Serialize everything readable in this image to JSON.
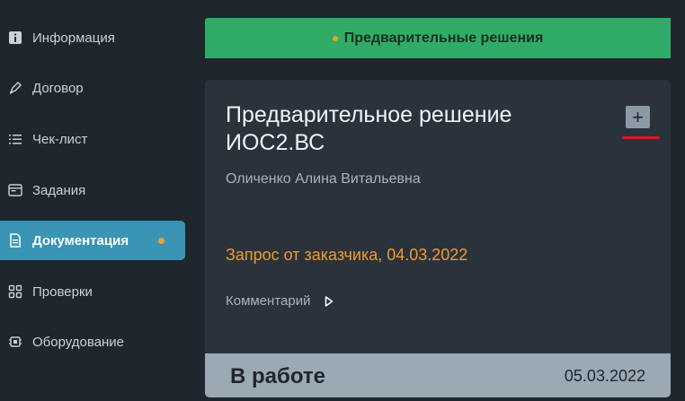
{
  "sidebar": {
    "items": [
      {
        "label": "Информация",
        "icon": "info-icon",
        "active": false
      },
      {
        "label": "Договор",
        "icon": "pen-icon",
        "active": false
      },
      {
        "label": "Чек-лист",
        "icon": "checklist-icon",
        "active": false
      },
      {
        "label": "Задания",
        "icon": "tasks-icon",
        "active": false
      },
      {
        "label": "Документация",
        "icon": "document-icon",
        "active": true,
        "has_badge_dot": true
      },
      {
        "label": "Проверки",
        "icon": "grid-icon",
        "active": false
      },
      {
        "label": "Оборудование",
        "icon": "chip-icon",
        "active": false
      }
    ]
  },
  "banner": {
    "label": "Предварительные решения"
  },
  "card": {
    "title": "Предварительное решение ИОС2.ВС",
    "add_label": "+",
    "person": "Оличенко Алина Витальевна",
    "request": "Запрос от заказчика, 04.03.2022",
    "comment_label": "Комментарий",
    "status": "В работе",
    "status_date": "05.03.2022"
  },
  "colors": {
    "background": "#1f262d",
    "active_nav": "#3a95b5",
    "banner": "#2fac68",
    "card": "#2a333c",
    "request_text": "#f29a2e",
    "status_bar": "#9aa9b4",
    "dot": "#f0a030",
    "underline": "#e0151b"
  }
}
